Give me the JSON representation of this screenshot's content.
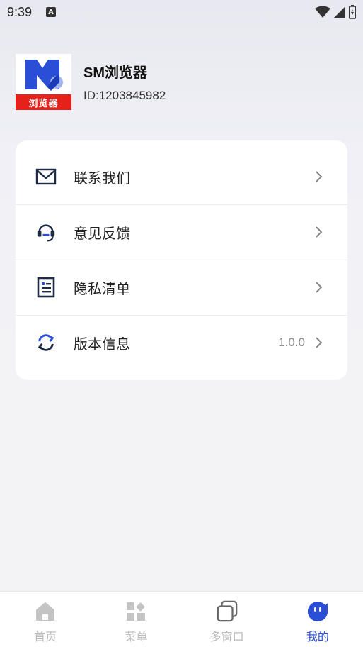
{
  "status": {
    "time": "9:39",
    "badge": "A"
  },
  "profile": {
    "logo_text": "浏览器",
    "name": "SM浏览器",
    "id_text": "ID:1203845982"
  },
  "menu": [
    {
      "label": "联系我们",
      "icon": "mail-icon",
      "value": ""
    },
    {
      "label": "意见反馈",
      "icon": "headset-icon",
      "value": ""
    },
    {
      "label": "隐私清单",
      "icon": "document-icon",
      "value": ""
    },
    {
      "label": "版本信息",
      "icon": "refresh-icon",
      "value": "1.0.0"
    }
  ],
  "tabs": [
    {
      "label": "首页",
      "icon": "home-icon",
      "active": false
    },
    {
      "label": "菜单",
      "icon": "grid-icon",
      "active": false
    },
    {
      "label": "多窗口",
      "icon": "windows-icon",
      "active": false
    },
    {
      "label": "我的",
      "icon": "profile-face-icon",
      "active": true
    }
  ],
  "colors": {
    "accent": "#2a4fd6",
    "brand_red": "#e5211c",
    "icon_dark": "#1f2a44",
    "inactive": "#bbbbbb"
  }
}
